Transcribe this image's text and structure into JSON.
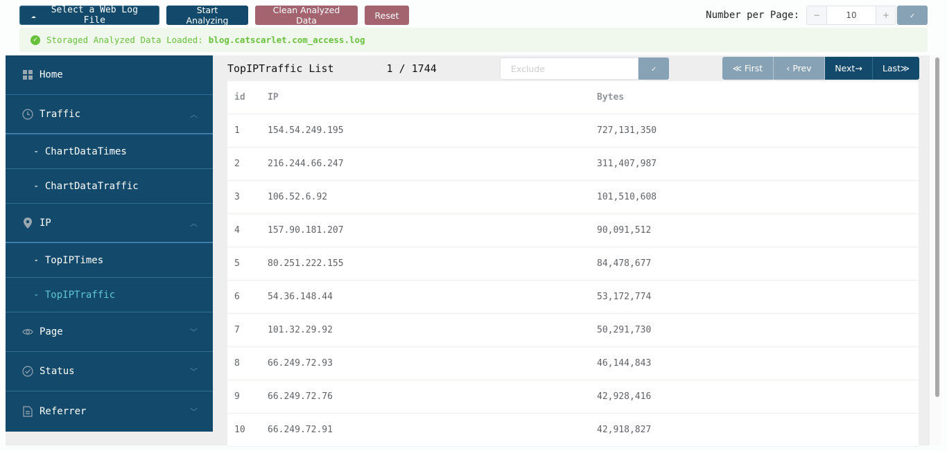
{
  "toolbar": {
    "select_file": "Select a Web Log File",
    "start": "Start Analyzing",
    "clean": "Clean Analyzed Data",
    "reset": "Reset",
    "number_per_page_label": "Number per Page:",
    "number_per_page": "10",
    "minus": "−",
    "plus": "+",
    "confirm": "✓"
  },
  "alert": {
    "message": "Storaged Analyzed Data Loaded:",
    "filename": "blog.catscarlet.com_access.log"
  },
  "sidebar": {
    "items": [
      {
        "label": "Home",
        "icon": "grid-icon"
      },
      {
        "label": "Traffic",
        "icon": "clock-icon",
        "expanded": true,
        "children": [
          "- ChartDataTimes",
          "- ChartDataTraffic"
        ]
      },
      {
        "label": "IP",
        "icon": "location-pin-icon",
        "expanded": true,
        "children": [
          "- TopIPTimes",
          "- TopIPTraffic"
        ]
      },
      {
        "label": "Page",
        "icon": "eye-icon",
        "expanded": false
      },
      {
        "label": "Status",
        "icon": "check-circle-icon",
        "expanded": false
      },
      {
        "label": "Referrer",
        "icon": "document-icon",
        "expanded": false
      }
    ],
    "active": "- TopIPTraffic"
  },
  "main": {
    "title": "TopIPTraffic List",
    "page": "1 / 1744",
    "exclude_placeholder": "Exclude",
    "exclude_confirm": "✓",
    "pager": {
      "first": "≪ First",
      "prev": "‹ Prev",
      "next": "Next→",
      "last": "Last≫"
    },
    "columns": [
      "id",
      "IP",
      "Bytes"
    ],
    "rows": [
      {
        "id": "1",
        "ip": "154.54.249.195",
        "bytes": "727,131,350"
      },
      {
        "id": "2",
        "ip": "216.244.66.247",
        "bytes": "311,407,987"
      },
      {
        "id": "3",
        "ip": "106.52.6.92",
        "bytes": "101,510,608"
      },
      {
        "id": "4",
        "ip": "157.90.181.207",
        "bytes": "90,091,512"
      },
      {
        "id": "5",
        "ip": "80.251.222.155",
        "bytes": "84,478,677"
      },
      {
        "id": "6",
        "ip": "54.36.148.44",
        "bytes": "53,172,774"
      },
      {
        "id": "7",
        "ip": "101.32.29.92",
        "bytes": "50,291,730"
      },
      {
        "id": "8",
        "ip": "66.249.72.93",
        "bytes": "46,144,843"
      },
      {
        "id": "9",
        "ip": "66.249.72.76",
        "bytes": "42,928,416"
      },
      {
        "id": "10",
        "ip": "66.249.72.91",
        "bytes": "42,918,827"
      }
    ]
  },
  "colors": {
    "primary": "#134a6b",
    "danger_muted": "#a3636f",
    "disabled": "#87a2b5",
    "success": "#67c23a",
    "active_link": "#5fc6cf"
  }
}
